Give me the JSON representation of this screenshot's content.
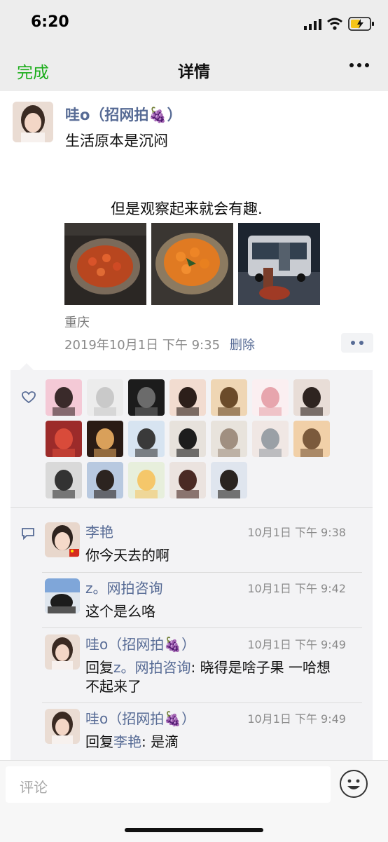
{
  "status": {
    "time": "6:20"
  },
  "nav": {
    "done": "完成",
    "title": "详情"
  },
  "post": {
    "author": "哇o（招网拍🍇）",
    "line1": "生活原本是沉闷",
    "line2": "但是观察起来就会有趣.",
    "location": "重庆",
    "date": "2019年10月1日  下午 9:35",
    "delete": "删除",
    "photos": [
      "photo-fruit-plate",
      "photo-orange-fruit",
      "photo-night-bus"
    ]
  },
  "likes": {
    "count": 19
  },
  "comments": [
    {
      "name": "李艳",
      "time": "10月1日 下午 9:38",
      "text": "你今天去的啊"
    },
    {
      "name": "z。网拍咨询",
      "time": "10月1日 下午 9:42",
      "text": "这个是么咯"
    },
    {
      "name": "哇o（招网拍🍇）",
      "time": "10月1日 下午 9:49",
      "reply_prefix": "回复",
      "reply_to": "z。网拍咨询",
      "reply_sep": ": ",
      "text1": "晓得是啥子果 一哈想",
      "text2": "不起来了"
    },
    {
      "name": "哇o（招网拍🍇）",
      "time": "10月1日 下午 9:49",
      "reply_prefix": "回复",
      "reply_to": "李艳",
      "reply_sep": ": ",
      "text": "是滴"
    }
  ],
  "input": {
    "placeholder": "评论"
  },
  "colors": {
    "accent": "#1aad19",
    "link": "#576b95",
    "panel": "#f3f3f5"
  }
}
